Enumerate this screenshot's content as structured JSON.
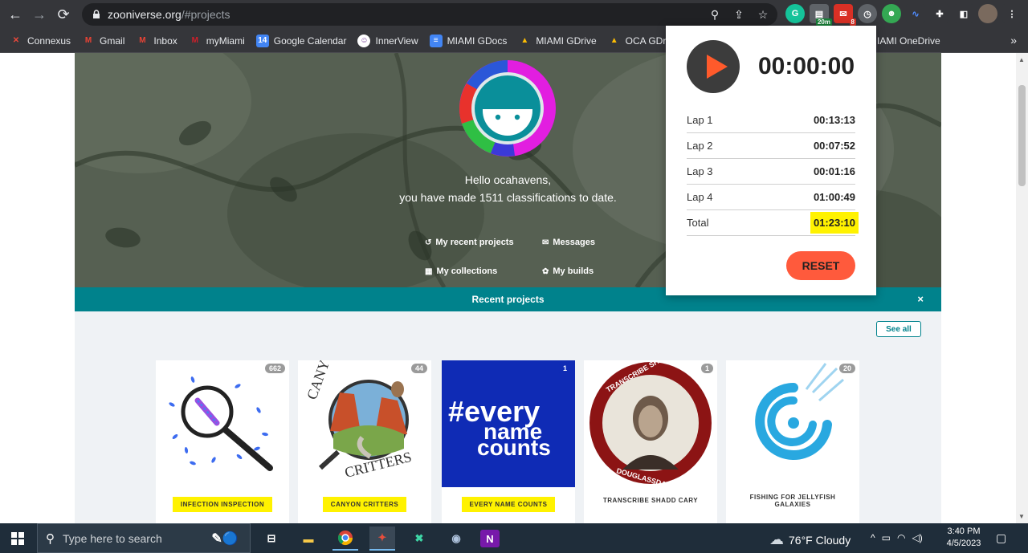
{
  "browser": {
    "url_host": "zooniverse.org",
    "url_path": "/#projects",
    "extension_badges": {
      "timer": "20m",
      "gmail": "8"
    },
    "bookmarks": [
      "Connexus",
      "Gmail",
      "Inbox",
      "myMiami",
      "Google Calendar",
      "InnerView",
      "MIAMI GDocs",
      "MIAMI GDrive",
      "OCA GDrive"
    ],
    "bookmark_hidden_partial": "IAMI OneDrive",
    "bookmarks_more": "»"
  },
  "hero": {
    "greeting_line1": "Hello ocahavens,",
    "greeting_line2": "you have made 1511 classifications to date.",
    "links": {
      "recent_projects": "My recent projects",
      "messages": "Messages",
      "collections": "My collections",
      "builds": "My builds"
    }
  },
  "recent": {
    "title": "Recent projects",
    "close": "×",
    "see_all": "See all",
    "projects": [
      {
        "title": "INFECTION INSPECTION",
        "count": "662",
        "highlighted": true
      },
      {
        "title": "CANYON CRITTERS",
        "count": "44",
        "highlighted": true
      },
      {
        "title": "EVERY NAME COUNTS",
        "count": "1",
        "highlighted": true
      },
      {
        "title": "TRANSCRIBE SHADD CARY",
        "count": "1",
        "highlighted": false
      },
      {
        "title": "FISHING FOR JELLYFISH GALAXIES",
        "count": "20",
        "highlighted": false
      }
    ],
    "image_text": {
      "canyon_top": "CANYON",
      "canyon_bottom": "CRITTERS",
      "enc_line1": "#every",
      "enc_line2": "name",
      "enc_line3": "counts",
      "shadd_top": "TRANSCRIBE SHADD CARY",
      "shadd_bottom": "DOUGLASSDAY.ORG"
    }
  },
  "stopwatch": {
    "time": "00:00:00",
    "laps": [
      {
        "label": "Lap 1",
        "value": "00:13:13"
      },
      {
        "label": "Lap 2",
        "value": "00:07:52"
      },
      {
        "label": "Lap 3",
        "value": "00:01:16"
      },
      {
        "label": "Lap 4",
        "value": "01:00:49"
      }
    ],
    "total_label": "Total",
    "total_value": "01:23:10",
    "reset_label": "RESET",
    "accent_color": "#ff5a3c"
  },
  "taskbar": {
    "search_placeholder": "Type here to search",
    "weather": "76°F  Cloudy",
    "time": "3:40 PM",
    "date": "4/5/2023"
  }
}
